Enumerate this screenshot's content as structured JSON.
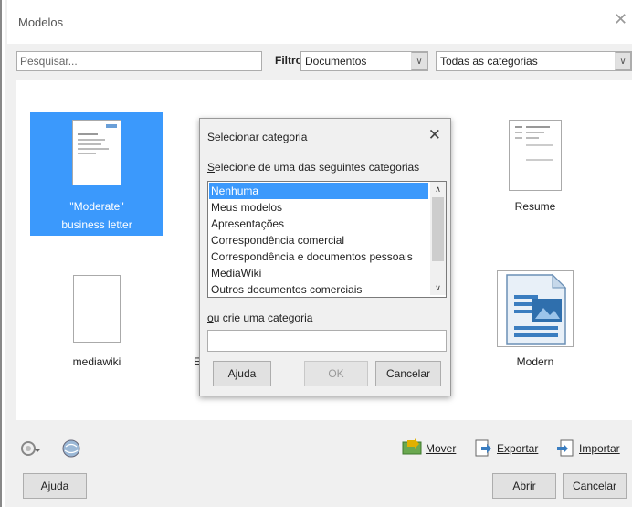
{
  "window": {
    "title": "Modelos"
  },
  "toolbar": {
    "search_placeholder": "Pesquisar...",
    "filter_label": "Filtro",
    "filter_value": "Documentos",
    "category_value": "Todas as categorias"
  },
  "gallery": {
    "templates": [
      {
        "label": "\"Moderate\"",
        "label2": "business letter",
        "selected": true
      },
      {
        "label": "Resume"
      },
      {
        "label": "mediawiki"
      },
      {
        "label": "E"
      },
      {
        "label": "Modern"
      }
    ]
  },
  "dialog": {
    "title": "Selecionar categoria",
    "prompt": "Selecione de uma das seguintes categorias",
    "categories": [
      "Nenhuma",
      "Meus modelos",
      "Apresentações",
      "Correspondência comercial",
      "Correspondência e documentos pessoais",
      "MediaWiki",
      "Outros documentos comerciais"
    ],
    "selected_category": "Nenhuma",
    "new_category_label": "ou crie uma categoria",
    "new_category_value": "",
    "help_label": "Ajuda",
    "ok_label": "OK",
    "cancel_label": "Cancelar"
  },
  "actions": {
    "move_label": "Mover",
    "export_label": "Exportar",
    "import_label": "Importar"
  },
  "footer": {
    "help_label": "Ajuda",
    "open_label": "Abrir",
    "cancel_label": "Cancelar"
  },
  "colors": {
    "selection": "#3b99fc",
    "dialog_bg": "#f0f0f0"
  }
}
